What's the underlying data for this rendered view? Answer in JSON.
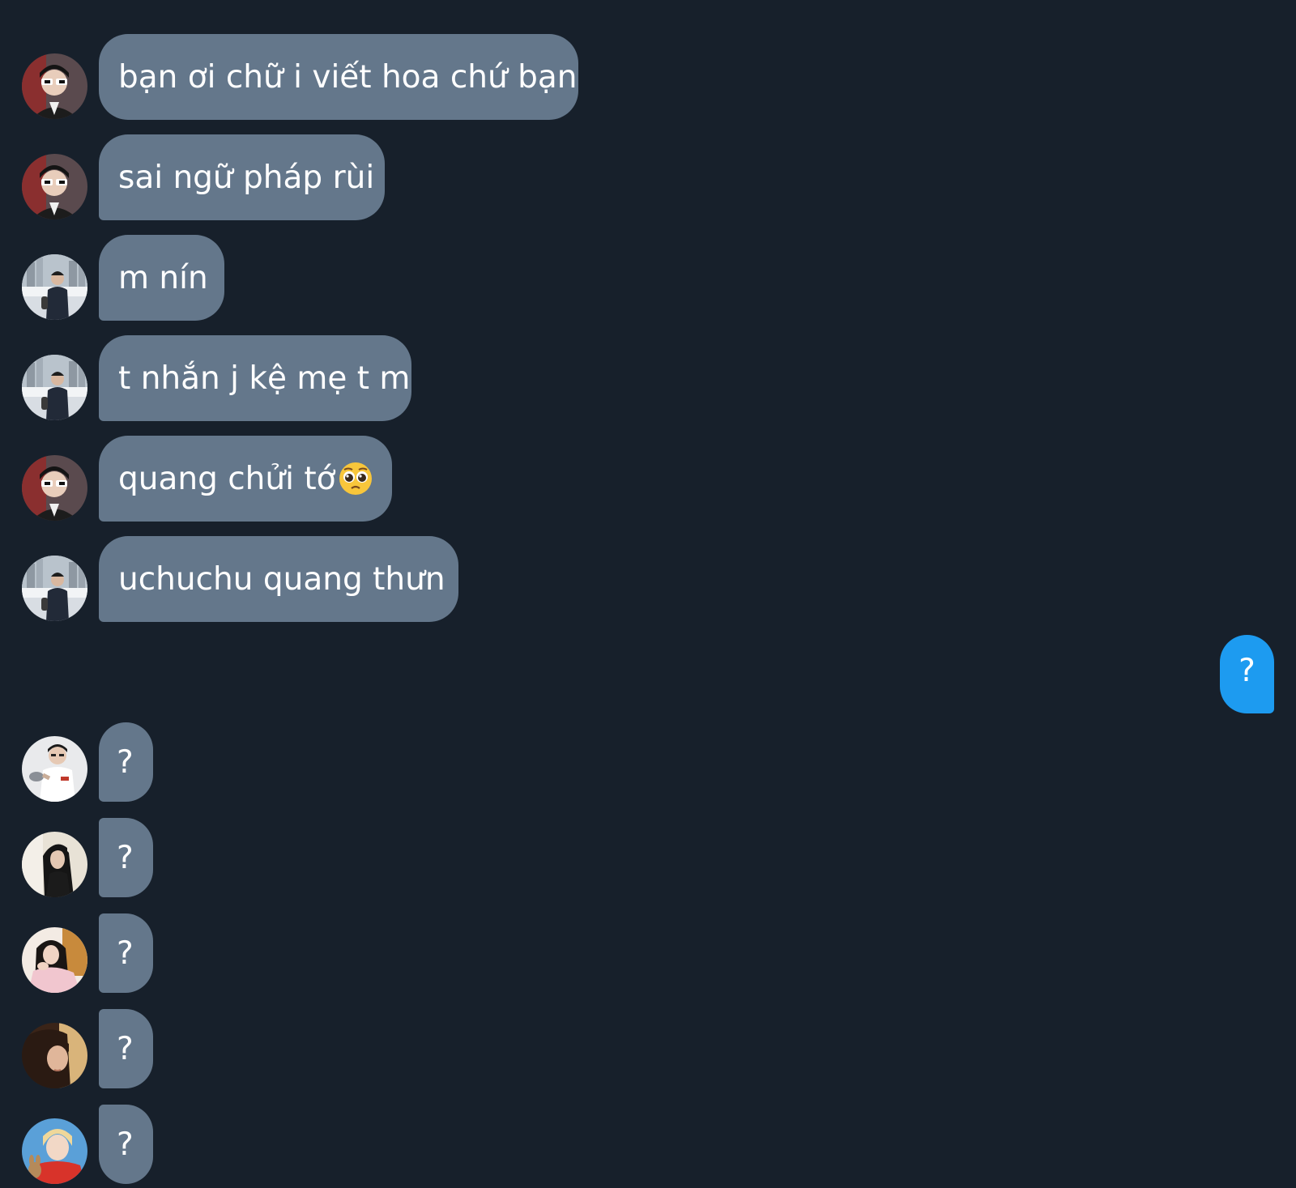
{
  "conversation": {
    "received": [
      {
        "text": "bạn ơi chữ i viết hoa chứ bạn",
        "avatar": "avatar-sunglasses-man"
      },
      {
        "text": "sai ngữ pháp rùi",
        "avatar": "avatar-sunglasses-man"
      },
      {
        "text": "m nín",
        "avatar": "avatar-city-person"
      },
      {
        "text": "t nhắn j kệ mẹ t m",
        "avatar": "avatar-city-person"
      },
      {
        "text": "quang chửi tớ",
        "emoji": "pleading-face-emoji",
        "avatar": "avatar-sunglasses-man"
      },
      {
        "text": "uchuchu quang thưn",
        "avatar": "avatar-city-person"
      }
    ],
    "sent": {
      "text": "?"
    },
    "replies": [
      {
        "text": "?",
        "avatar": "avatar-white-shirt-man"
      },
      {
        "text": "?",
        "avatar": "avatar-dark-hair-woman"
      },
      {
        "text": "?",
        "avatar": "avatar-pink-sweater-woman"
      },
      {
        "text": "?",
        "avatar": "avatar-warm-light-woman"
      },
      {
        "text": "?",
        "avatar": "avatar-blonde-red-shirt"
      }
    ]
  },
  "colors": {
    "background": "#17202b",
    "received_bubble": "#64778b",
    "sent_bubble": "#1d9bf0",
    "text": "#ffffff"
  }
}
